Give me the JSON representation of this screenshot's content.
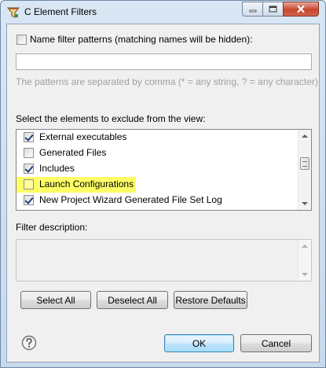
{
  "window": {
    "title": "C Element Filters",
    "icon": "filter-funnel-icon"
  },
  "name_filter": {
    "checkbox_label": "Name filter patterns (matching names will be hidden):",
    "checked": false,
    "value": "",
    "hint": "The patterns are separated by comma (* = any string, ? = any character)"
  },
  "exclude_section": {
    "label": "Select the elements to exclude from the view:",
    "items": [
      {
        "label": "External executables",
        "checked": true
      },
      {
        "label": "Generated Files",
        "checked": false
      },
      {
        "label": "Includes",
        "checked": true
      },
      {
        "label": "Launch Configurations",
        "checked": false,
        "highlighted": true
      },
      {
        "label": "New Project Wizard Generated File Set Log",
        "checked": true
      }
    ]
  },
  "filter_description": {
    "label": "Filter description:",
    "value": ""
  },
  "buttons": {
    "select_all": "Select All",
    "deselect_all": "Deselect All",
    "restore_defaults": "Restore Defaults",
    "ok": "OK",
    "cancel": "Cancel"
  },
  "colors": {
    "highlight": "#ffff66",
    "default_button_border": "#3c7fb1",
    "close_button": "#c8442d"
  }
}
